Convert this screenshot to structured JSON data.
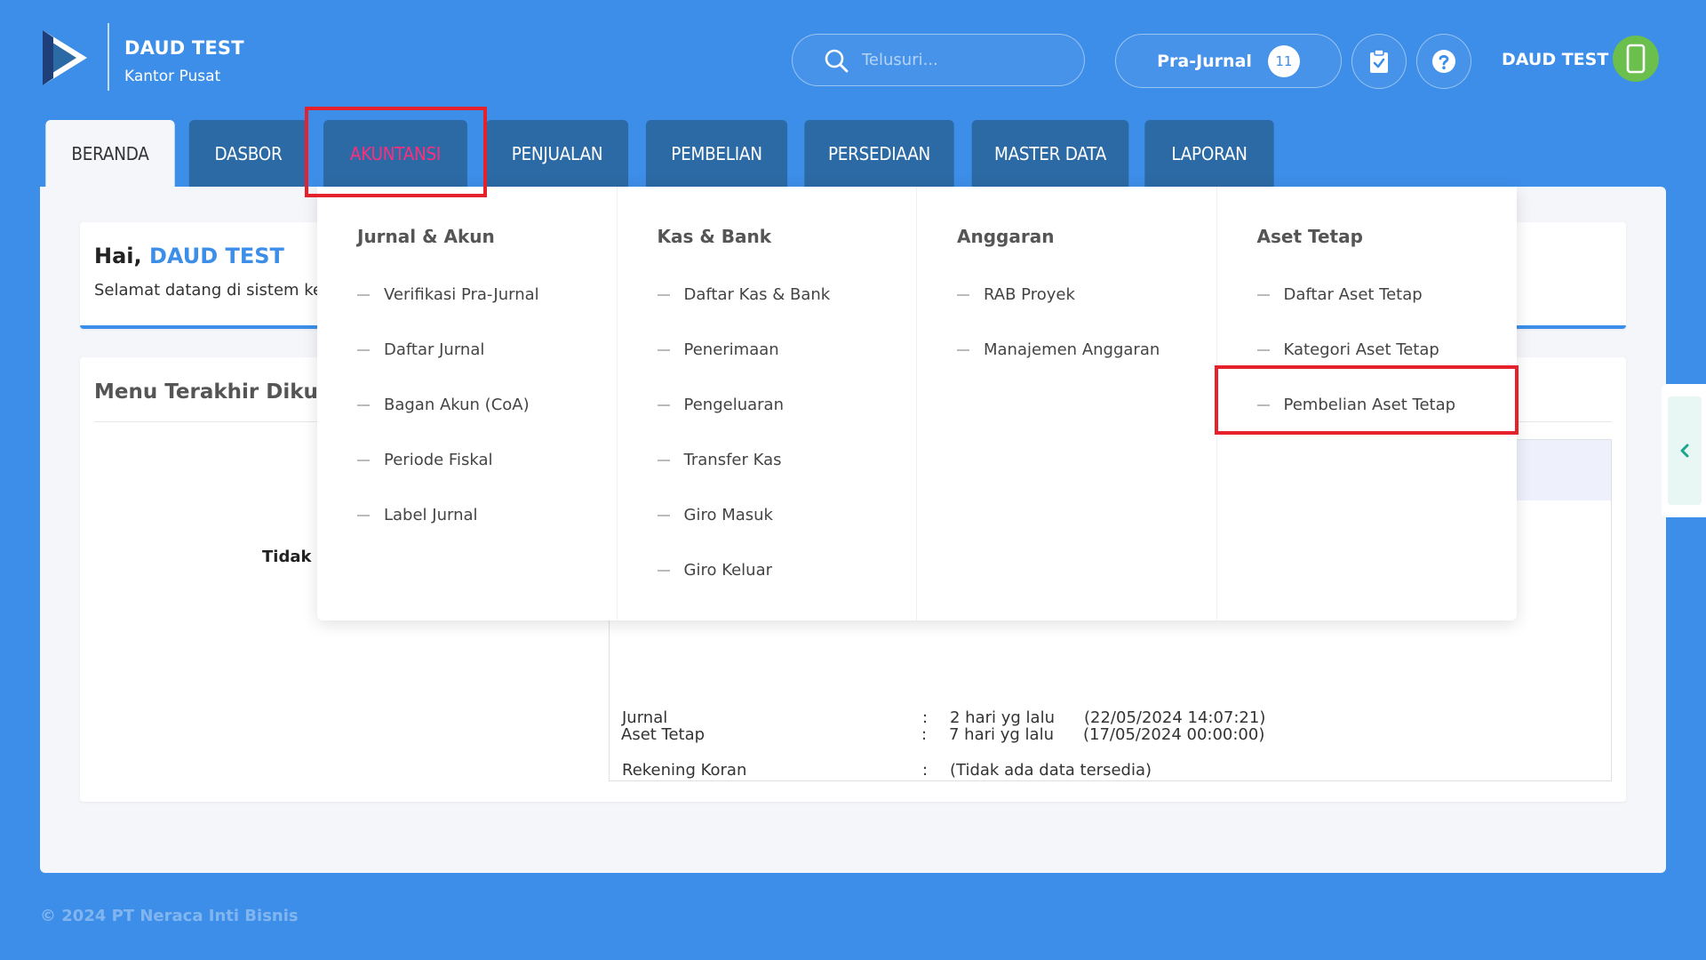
{
  "company": {
    "name": "DAUD TEST",
    "branch": "Kantor Pusat"
  },
  "search": {
    "placeholder": "Telusuri..."
  },
  "pra_jurnal": {
    "label": "Pra-Jurnal",
    "count": "11"
  },
  "user": {
    "name": "DAUD TEST"
  },
  "tabs": [
    {
      "label": "BERANDA"
    },
    {
      "label": "DASBOR"
    },
    {
      "label": "AKUNTANSI"
    },
    {
      "label": "PENJUALAN"
    },
    {
      "label": "PEMBELIAN"
    },
    {
      "label": "PERSEDIAAN"
    },
    {
      "label": "MASTER DATA"
    },
    {
      "label": "LAPORAN"
    }
  ],
  "welcome": {
    "greeting": "Hai,",
    "name": "DAUD TEST",
    "text": "Selamat datang di sistem ke"
  },
  "recent": {
    "title": "Menu Terakhir Dikunju",
    "empty": "Tidak a"
  },
  "status_rows": [
    {
      "label": "Jurnal",
      "colon": ":",
      "relative": "2 hari yg lalu",
      "date": "(22/05/2024 14:07:21)"
    },
    {
      "label": "Rekening Koran",
      "colon": ":",
      "empty": "(Tidak ada data tersedia)"
    },
    {
      "label": "Aset Tetap",
      "colon": ":",
      "relative": "7 hari yg lalu",
      "date": "(17/05/2024 00:00:00)"
    }
  ],
  "dropdown": {
    "columns": [
      {
        "heading": "Jurnal & Akun",
        "items": [
          "Verifikasi Pra-Jurnal",
          "Daftar Jurnal",
          "Bagan Akun (CoA)",
          "Periode Fiskal",
          "Label Jurnal"
        ]
      },
      {
        "heading": "Kas & Bank",
        "items": [
          "Daftar Kas & Bank",
          "Penerimaan",
          "Pengeluaran",
          "Transfer Kas",
          "Giro Masuk",
          "Giro Keluar"
        ]
      },
      {
        "heading": "Anggaran",
        "items": [
          "RAB Proyek",
          "Manajemen Anggaran"
        ]
      },
      {
        "heading": "Aset Tetap",
        "items": [
          "Daftar Aset Tetap",
          "Kategori Aset Tetap",
          "Pembelian Aset Tetap"
        ]
      }
    ]
  },
  "footer": {
    "text": "© 2024 PT Neraca Inti Bisnis"
  },
  "colors": {
    "background": "#3d8ee8",
    "tab": "#2c6aa5",
    "tab_highlight_text": "#ff2e7d",
    "annotation": "#e5222c",
    "avatar": "#6bbf4d"
  },
  "icons": [
    "logo-icon",
    "search-icon",
    "clipboard-check-icon",
    "help-icon",
    "phone-icon",
    "chevron-left-icon"
  ]
}
